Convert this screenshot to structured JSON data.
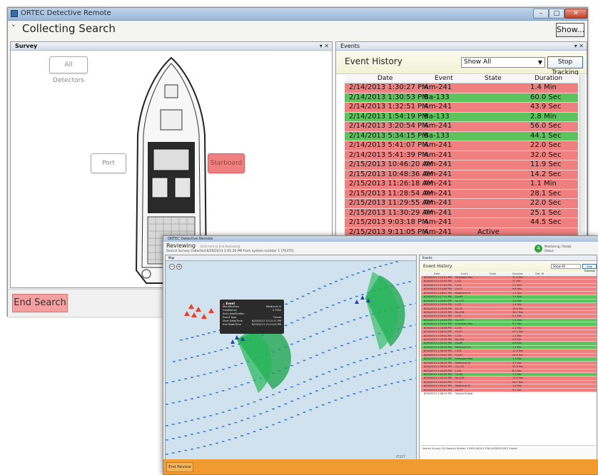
{
  "colors": {
    "alert_red": "#f08080",
    "ok_green": "#5cc45c",
    "review_orange": "#f09a30",
    "accent_blue": "#2f6fb5"
  },
  "window1": {
    "title": "ORTEC Detective Remote",
    "heading": "Collecting Search",
    "show_label": "Show...",
    "survey": {
      "tab": "Survey",
      "zones": {
        "all": "All Detectors",
        "port": "Port",
        "starboard": "Starboard"
      }
    },
    "events": {
      "tab": "Events",
      "title": "Event History",
      "filter": "Show All",
      "stop_tracking": "Stop Tracking",
      "columns": [
        "Date",
        "Event",
        "State",
        "Duration"
      ],
      "rows": [
        {
          "date": "2/14/2013 1:30:27 PM",
          "event": "Am-241",
          "state": "",
          "duration": "1.4 Min",
          "status": "red"
        },
        {
          "date": "2/14/2013 1:30:53 PM",
          "event": "Ba-133",
          "state": "",
          "duration": "60.0 Sec",
          "status": "green"
        },
        {
          "date": "2/14/2013 1:32:51 PM",
          "event": "Am-241",
          "state": "",
          "duration": "43.9 Sec",
          "status": "red"
        },
        {
          "date": "2/14/2013 1:54:19 PM",
          "event": "Ba-133",
          "state": "",
          "duration": "2.8 Min",
          "status": "green"
        },
        {
          "date": "2/14/2013 3:20:54 PM",
          "event": "Am-241",
          "state": "",
          "duration": "56.0 Sec",
          "status": "red"
        },
        {
          "date": "2/14/2013 5:34:15 PM",
          "event": "Ba-133",
          "state": "",
          "duration": "44.1 Sec",
          "status": "green"
        },
        {
          "date": "2/14/2013 5:41:07 PM",
          "event": "Am-241",
          "state": "",
          "duration": "22.0 Sec",
          "status": "red"
        },
        {
          "date": "2/14/2013 5:41:39 PM",
          "event": "Am-241",
          "state": "",
          "duration": "32.0 Sec",
          "status": "red"
        },
        {
          "date": "2/15/2013 10:46:20 AM",
          "event": "Am-241",
          "state": "",
          "duration": "11.9 Sec",
          "status": "red"
        },
        {
          "date": "2/15/2013 10:48:36 AM",
          "event": "Am-241",
          "state": "",
          "duration": "14.2 Sec",
          "status": "red"
        },
        {
          "date": "2/15/2013 11:26:18 AM",
          "event": "Am-241",
          "state": "",
          "duration": "1.1 Min",
          "status": "red"
        },
        {
          "date": "2/15/2013 11:28:54 AM",
          "event": "Am-241",
          "state": "",
          "duration": "28.1 Sec",
          "status": "red"
        },
        {
          "date": "2/15/2013 11:29:55 AM",
          "event": "Am-241",
          "state": "",
          "duration": "22.0 Sec",
          "status": "red"
        },
        {
          "date": "2/15/2013 11:30:29 AM",
          "event": "Am-241",
          "state": "",
          "duration": "25.1 Sec",
          "status": "red"
        },
        {
          "date": "2/15/2013 9:03:18 PM",
          "event": "Am-241",
          "state": "",
          "duration": "44.5 Sec",
          "status": "red"
        },
        {
          "date": "2/15/2013 9:11:05 PM",
          "event": "Am-241",
          "state": "Active",
          "duration": "",
          "status": "red"
        }
      ]
    },
    "end_search": "End Search"
  },
  "window2": {
    "title": "ORTEC Detective Remote",
    "heading": "Reviewing",
    "subheading": "Click here to End Reviewing",
    "search_info": "Search Survey Collected 8/20/2013 1:01:26 PM from system number 1 (70375)",
    "status_icon": "4",
    "right_info_1": "Monitoring / Ready",
    "right_info_2": "Status",
    "map": {
      "tab": "Map",
      "zoom_in": "+",
      "zoom_out": "−",
      "popup": {
        "title": "Event",
        "rows": [
          {
            "k": "Identification",
            "v": "Medicinal I3"
          },
          {
            "k": "Confidence",
            "v": "0.7000"
          },
          {
            "k": "Sub classification",
            "v": ""
          },
          {
            "k": "Event Type",
            "v": "Threat"
          },
          {
            "k": "Start Date/Time",
            "v": "8/20/2013 13:10:11 PM"
          },
          {
            "k": "End Date/Time",
            "v": "8/20/2013 13:11:05 PM"
          }
        ]
      },
      "esri": "esri",
      "bottom_buttons": [
        "Nearest",
        "Satellite",
        "Topo",
        "Street",
        "Show/Hide Layers"
      ],
      "auto_tracking": "Auto Tracking"
    },
    "events": {
      "tab": "Events",
      "title": "Event History",
      "filter": "Show All",
      "stop_tracking": "Stop Tracking",
      "columns": [
        "Date",
        "Event",
        "State",
        "Duration",
        "Det. ID"
      ],
      "rows": [
        {
          "date": "8/20/2013 1:10:11 PM",
          "event": "Unknown Neu.",
          "state": "",
          "duration": "21.0 Sec",
          "status": "red"
        },
        {
          "date": "8/20/2013 1:10:45 PM",
          "event": "I-131",
          "state": "",
          "duration": "17 Min",
          "status": "red"
        },
        {
          "date": "8/20/2013 1:11:03 PM",
          "event": "I-131",
          "state": "",
          "duration": "7.1 Min",
          "status": "red"
        },
        {
          "date": "8/20/2013 1:14:45 PM",
          "event": "Co-57",
          "state": "",
          "duration": "9.8 Sec",
          "status": "red"
        },
        {
          "date": "8/20/2013 1:16:02 PM",
          "event": "Medicinal I3",
          "state": "",
          "duration": "1.1 Sec",
          "status": "red"
        },
        {
          "date": "8/20/2013 1:17:11 PM",
          "event": "Co-60",
          "state": "",
          "duration": "1.1 Min",
          "status": "green"
        },
        {
          "date": "8/20/2013 1:18:20 PM",
          "event": "Cs-137",
          "state": "",
          "duration": "2.6 Sec",
          "status": "green"
        },
        {
          "date": "8/20/2013 1:19:34 PM",
          "event": "I-131",
          "state": "",
          "duration": "1.4 Min",
          "status": "red"
        },
        {
          "date": "8/20/2013 1:20:45 PM",
          "event": "Co-57",
          "state": "",
          "duration": "15.6 Sec",
          "status": "red"
        },
        {
          "date": "8/20/2013 1:22:03 PM",
          "event": "Ra-226",
          "state": "",
          "duration": "38.2 Sec",
          "status": "red"
        },
        {
          "date": "8/20/2013 1:23:11 PM",
          "event": "I-131",
          "state": "",
          "duration": "5.1 Min",
          "status": "red"
        },
        {
          "date": "8/20/2013 1:24:30 PM",
          "event": "Cs-137",
          "state": "",
          "duration": "1.1 Min",
          "status": "green"
        },
        {
          "date": "8/20/2013 1:25:41 PM",
          "event": "Unknown Neu.",
          "state": "",
          "duration": "9.7 Sec",
          "status": "green"
        },
        {
          "date": "8/20/2013 1:26:56 PM",
          "event": "I-131",
          "state": "",
          "duration": "2.2 Min",
          "status": "red"
        },
        {
          "date": "8/20/2013 1:28:10 PM",
          "event": "Co-57",
          "state": "",
          "duration": "47.1 Sec",
          "status": "red"
        },
        {
          "date": "8/20/2013 1:29:22 PM",
          "event": "I-131",
          "state": "",
          "duration": "1.2 Min",
          "status": "red"
        },
        {
          "date": "8/20/2013 1:30:45 PM",
          "event": "Ra-226",
          "state": "",
          "duration": "9.8 Sec",
          "status": "red"
        },
        {
          "date": "8/20/2013 1:32:01 PM",
          "event": "Co-60",
          "state": "",
          "duration": "2.6 Min",
          "status": "green"
        },
        {
          "date": "8/20/2013 1:33:14 PM",
          "event": "Medicinal I3",
          "state": "",
          "duration": "1.1 Min",
          "status": "green"
        },
        {
          "date": "8/20/2013 1:34:30 PM",
          "event": "I-131",
          "state": "",
          "duration": "11.2 Sec",
          "status": "red"
        },
        {
          "date": "8/20/2013 1:35:47 PM",
          "event": "Co-57",
          "state": "",
          "duration": "22.4 Sec",
          "status": "red"
        },
        {
          "date": "8/20/2013 1:37:02 PM",
          "event": "Unknown Neu.",
          "state": "",
          "duration": "1.3 Min",
          "status": "green"
        },
        {
          "date": "8/20/2013 1:38:15 PM",
          "event": "Medicinal I3",
          "state": "",
          "duration": "4.1 Sec",
          "status": "red"
        },
        {
          "date": "8/20/2013 1:39:30 PM",
          "event": "Cs-137",
          "state": "",
          "duration": "33.9 Sec",
          "status": "red"
        },
        {
          "date": "8/20/2013 1:40:45 PM",
          "event": "I-131",
          "state": "",
          "duration": "8.2 Sec",
          "status": "red"
        },
        {
          "date": "8/20/2013 1:42:02 PM",
          "event": "Co-60",
          "state": "",
          "duration": "1.1 Min",
          "status": "green"
        },
        {
          "date": "8/20/2013 1:43:15 PM",
          "event": "Ra-226",
          "state": "",
          "duration": "14.5 Sec",
          "status": "red"
        },
        {
          "date": "8/20/2013 1:44:30 PM",
          "event": "I-131",
          "state": "",
          "duration": "54.7 Sec",
          "status": "red"
        },
        {
          "date": "8/20/2013 1:45:47 PM",
          "event": "Medicinal I3",
          "state": "",
          "duration": "1.4 Min",
          "status": "red"
        },
        {
          "date": "8/20/2013 1:47:02 PM",
          "event": "Co-57",
          "state": "",
          "duration": "5.1 Sec",
          "status": "red"
        },
        {
          "date": "8/20/2013 1:48:15 PM",
          "event": "Search Ended",
          "state": "",
          "duration": "",
          "status": "white"
        }
      ],
      "footer": "Search Survey 2013search Riddler II 0000-0000-0136-0405D9700C5 Ended"
    },
    "end_review": "End Review"
  }
}
